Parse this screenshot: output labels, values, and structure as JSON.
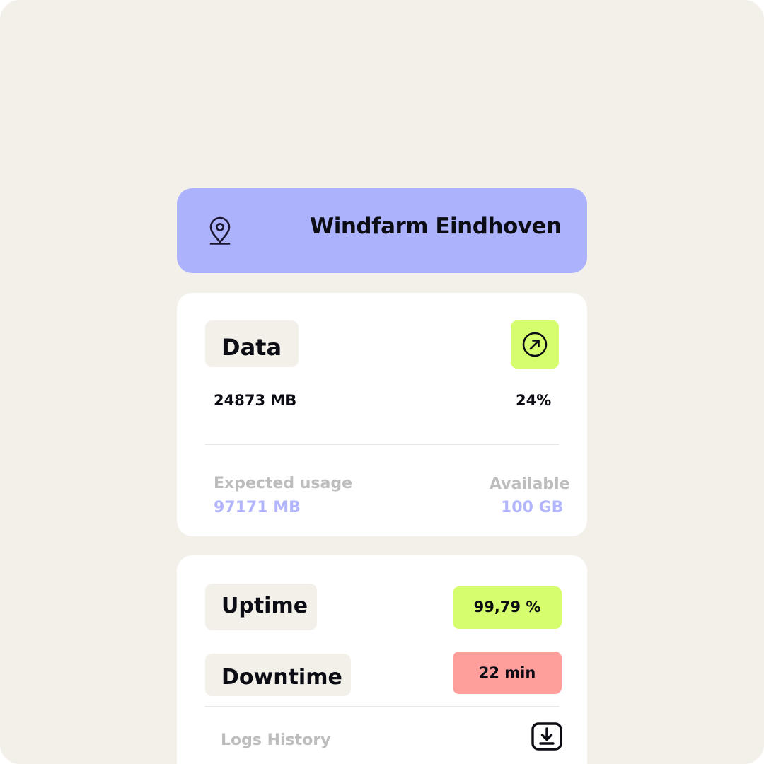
{
  "colors": {
    "background": "#f2f0e9",
    "header": "#adb2fc",
    "card": "#ffffff",
    "lime": "#d6fd6e",
    "red": "#ff9f9c",
    "accent_text": "#b2b5fb",
    "muted_text": "#bdbdbd"
  },
  "header": {
    "icon": "location-pin-icon",
    "title": "Windfarm Eindhoven"
  },
  "data_card": {
    "title": "Data",
    "open_icon": "arrow-up-right-circle-icon",
    "used": "24873 MB",
    "percent": "24%",
    "expected_label": "Expected usage",
    "expected_value": "97171 MB",
    "available_label": "Available",
    "available_value": "100 GB"
  },
  "status_card": {
    "uptime_label": "Uptime",
    "uptime_value": "99,79 %",
    "downtime_label": "Downtime",
    "downtime_value": "22 min",
    "logs_label": "Logs History",
    "download_icon": "download-icon"
  }
}
